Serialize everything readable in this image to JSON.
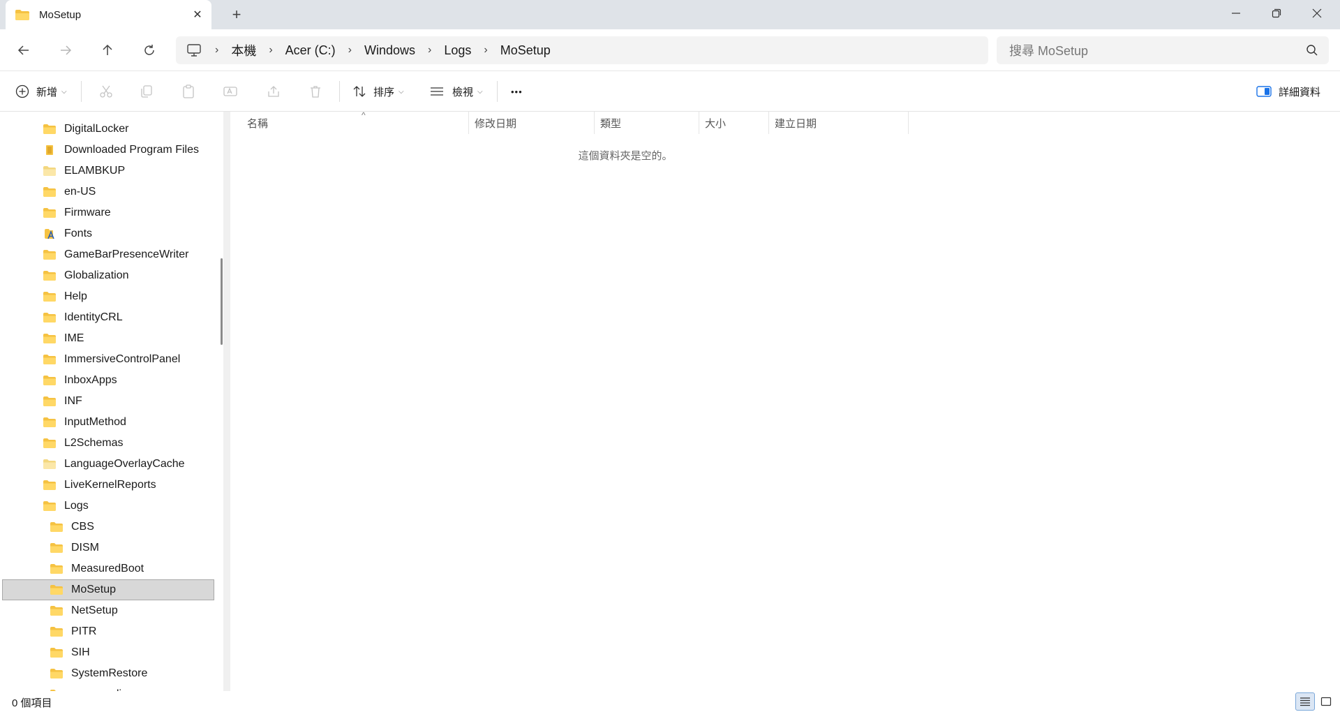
{
  "tab": {
    "title": "MoSetup",
    "close": "✕",
    "new_tab": "+"
  },
  "window_controls": {
    "minimize": "—",
    "maximize": "❐",
    "close": "✕"
  },
  "address": {
    "crumbs": [
      "本機",
      "Acer (C:)",
      "Windows",
      "Logs",
      "MoSetup"
    ],
    "separator": "›"
  },
  "search": {
    "placeholder": "搜尋 MoSetup"
  },
  "command_bar": {
    "new_label": "新增",
    "sort_label": "排序",
    "view_label": "檢視",
    "more_label": "•••",
    "details_label": "詳細資料"
  },
  "sidebar": {
    "items": [
      {
        "label": "DigitalLocker",
        "icon": "folder-icon",
        "level": 1
      },
      {
        "label": "Downloaded Program Files",
        "icon": "special-folder-icon",
        "level": 1
      },
      {
        "label": "ELAMBKUP",
        "icon": "folder-light-icon",
        "level": 1
      },
      {
        "label": "en-US",
        "icon": "folder-icon",
        "level": 1
      },
      {
        "label": "Firmware",
        "icon": "folder-icon",
        "level": 1
      },
      {
        "label": "Fonts",
        "icon": "fonts-folder-icon",
        "level": 1
      },
      {
        "label": "GameBarPresenceWriter",
        "icon": "folder-icon",
        "level": 1
      },
      {
        "label": "Globalization",
        "icon": "folder-icon",
        "level": 1
      },
      {
        "label": "Help",
        "icon": "folder-icon",
        "level": 1
      },
      {
        "label": "IdentityCRL",
        "icon": "folder-icon",
        "level": 1
      },
      {
        "label": "IME",
        "icon": "folder-icon",
        "level": 1
      },
      {
        "label": "ImmersiveControlPanel",
        "icon": "folder-icon",
        "level": 1
      },
      {
        "label": "InboxApps",
        "icon": "folder-icon",
        "level": 1
      },
      {
        "label": "INF",
        "icon": "folder-icon",
        "level": 1
      },
      {
        "label": "InputMethod",
        "icon": "folder-icon",
        "level": 1
      },
      {
        "label": "L2Schemas",
        "icon": "folder-icon",
        "level": 1
      },
      {
        "label": "LanguageOverlayCache",
        "icon": "folder-light-icon",
        "level": 1
      },
      {
        "label": "LiveKernelReports",
        "icon": "folder-icon",
        "level": 1
      },
      {
        "label": "Logs",
        "icon": "folder-icon",
        "level": 1
      },
      {
        "label": "CBS",
        "icon": "folder-icon",
        "level": 2
      },
      {
        "label": "DISM",
        "icon": "folder-icon",
        "level": 2
      },
      {
        "label": "MeasuredBoot",
        "icon": "folder-icon",
        "level": 2
      },
      {
        "label": "MoSetup",
        "icon": "folder-icon",
        "level": 2,
        "selected": true
      },
      {
        "label": "NetSetup",
        "icon": "folder-icon",
        "level": 2
      },
      {
        "label": "PITR",
        "icon": "folder-icon",
        "level": 2
      },
      {
        "label": "SIH",
        "icon": "folder-icon",
        "level": 2
      },
      {
        "label": "SystemRestore",
        "icon": "folder-icon",
        "level": 2
      },
      {
        "label": "waasmedic",
        "icon": "folder-icon",
        "level": 2
      }
    ]
  },
  "columns": {
    "name": "名稱",
    "modified": "修改日期",
    "type": "類型",
    "size": "大小",
    "created": "建立日期",
    "sort_indicator": "^"
  },
  "content": {
    "empty_message": "這個資料夾是空的。"
  },
  "status": {
    "item_count": "0 個項目"
  },
  "colors": {
    "folder": "#f5c242",
    "folder_light": "#f7dc8a",
    "selected_bg": "#d8d8d8",
    "accent": "#1a73e8"
  }
}
